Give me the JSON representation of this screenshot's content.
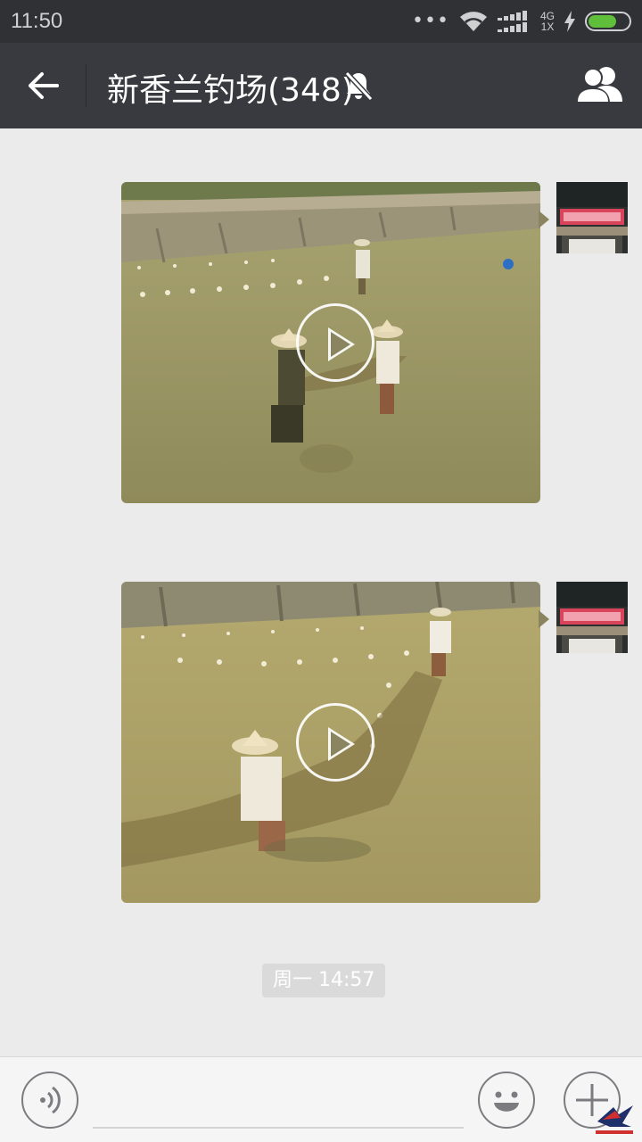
{
  "status_bar": {
    "time": "11:50",
    "network_top": "4G",
    "network_bottom": "1X",
    "battery_color": "#5fbf3a"
  },
  "header": {
    "title": "新香兰钓场(348)",
    "back_icon": "arrow-left-icon",
    "mute_icon": "bell-off-icon",
    "members_icon": "group-icon"
  },
  "messages": [
    {
      "type": "video",
      "sender": "self",
      "thumbnail": "pond-net-fishing-1"
    },
    {
      "type": "video",
      "sender": "self",
      "thumbnail": "pond-net-fishing-2"
    }
  ],
  "timestamp_badge": "周一 14:57",
  "input_bar": {
    "voice_icon": "voice-icon",
    "emoji_icon": "emoji-icon",
    "plus_icon": "plus-icon",
    "text_value": ""
  },
  "colors": {
    "title_bar": "#393a3f",
    "status_bar": "#2f3135",
    "chat_bg": "#ebebeb"
  }
}
